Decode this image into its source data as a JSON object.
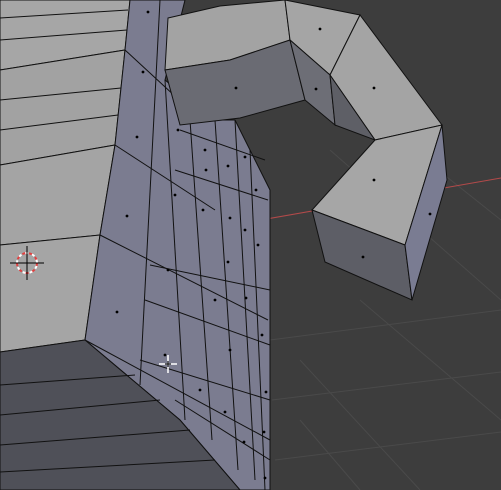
{
  "viewport": {
    "background_color": "#3d3d3d",
    "grid_color": "#4a4a4a",
    "x_axis_color": "#b34a4a",
    "face_light_color": "#a4a4a4",
    "face_mid_color": "#6f7078",
    "face_side_color": "#7a7b8e",
    "face_dark_color": "#4b4c53",
    "edge_color": "#111111",
    "vertex_color": "#000000"
  },
  "cursor": {
    "icon": "3d-cursor-icon",
    "color_red": "#e04040",
    "color_white": "#ffffff"
  },
  "mouse": {
    "icon": "mouse-crosshair-icon"
  }
}
